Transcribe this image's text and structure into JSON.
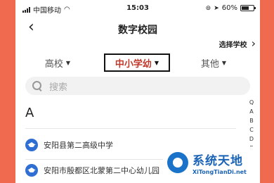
{
  "status_bar": {
    "carrier": "中国移动",
    "time": "15:03",
    "battery_percent": "60%",
    "battery_level": 0.6
  },
  "nav": {
    "back_icon": "‹",
    "title": "数字校园"
  },
  "select_school": {
    "label": "选择学校",
    "icon": "›"
  },
  "filters": [
    {
      "label": "高校",
      "active": false
    },
    {
      "label": "中小学幼",
      "active": true
    },
    {
      "label": "其他",
      "active": false
    }
  ],
  "search": {
    "placeholder": "搜索"
  },
  "section": {
    "header": "A"
  },
  "schools": [
    {
      "name": "安阳县第二高级中学"
    },
    {
      "name": "安阳市殷都区北蒙第二中心幼儿园"
    }
  ],
  "index_bar": [
    "Q",
    "A",
    "B",
    "C",
    "D",
    "E"
  ],
  "watermark": {
    "title": "系统天地",
    "subtitle": "XiTongTianDi.net"
  },
  "colors": {
    "background": "#ef6a4f",
    "active_filter": "#c0392b",
    "school_icon": "#2f6fd3",
    "watermark": "#1a63b5"
  },
  "icons": {
    "back": "chevron-left-icon",
    "select_school": "chevron-right-icon",
    "filter_caret": "caret-down-icon",
    "search": "search-icon",
    "school": "graduation-cap-icon",
    "wifi": "wifi-icon",
    "battery": "battery-icon",
    "lock": "orientation-lock-icon",
    "location": "location-arrow-icon"
  }
}
